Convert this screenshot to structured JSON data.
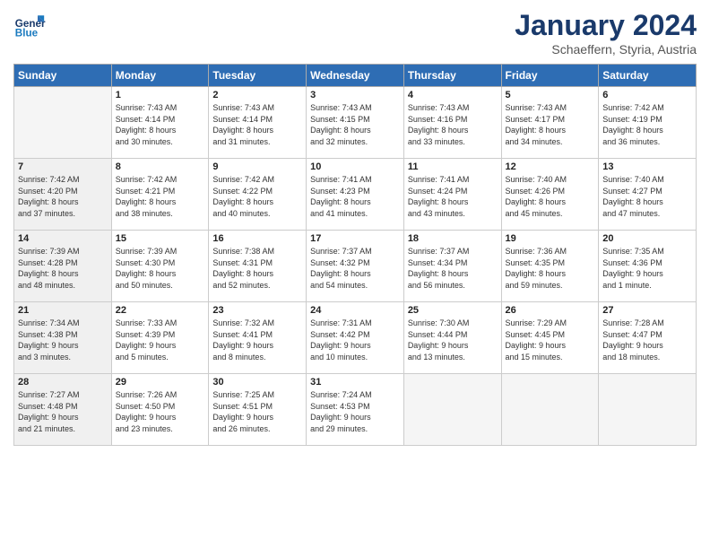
{
  "header": {
    "logo_general": "General",
    "logo_blue": "Blue",
    "month_title": "January 2024",
    "subtitle": "Schaeffern, Styria, Austria"
  },
  "weekdays": [
    "Sunday",
    "Monday",
    "Tuesday",
    "Wednesday",
    "Thursday",
    "Friday",
    "Saturday"
  ],
  "weeks": [
    [
      {
        "day": "",
        "info": "",
        "empty": true
      },
      {
        "day": "1",
        "info": "Sunrise: 7:43 AM\nSunset: 4:14 PM\nDaylight: 8 hours\nand 30 minutes."
      },
      {
        "day": "2",
        "info": "Sunrise: 7:43 AM\nSunset: 4:14 PM\nDaylight: 8 hours\nand 31 minutes."
      },
      {
        "day": "3",
        "info": "Sunrise: 7:43 AM\nSunset: 4:15 PM\nDaylight: 8 hours\nand 32 minutes."
      },
      {
        "day": "4",
        "info": "Sunrise: 7:43 AM\nSunset: 4:16 PM\nDaylight: 8 hours\nand 33 minutes."
      },
      {
        "day": "5",
        "info": "Sunrise: 7:43 AM\nSunset: 4:17 PM\nDaylight: 8 hours\nand 34 minutes."
      },
      {
        "day": "6",
        "info": "Sunrise: 7:42 AM\nSunset: 4:19 PM\nDaylight: 8 hours\nand 36 minutes."
      }
    ],
    [
      {
        "day": "7",
        "info": "Sunrise: 7:42 AM\nSunset: 4:20 PM\nDaylight: 8 hours\nand 37 minutes.",
        "shaded": true
      },
      {
        "day": "8",
        "info": "Sunrise: 7:42 AM\nSunset: 4:21 PM\nDaylight: 8 hours\nand 38 minutes."
      },
      {
        "day": "9",
        "info": "Sunrise: 7:42 AM\nSunset: 4:22 PM\nDaylight: 8 hours\nand 40 minutes."
      },
      {
        "day": "10",
        "info": "Sunrise: 7:41 AM\nSunset: 4:23 PM\nDaylight: 8 hours\nand 41 minutes."
      },
      {
        "day": "11",
        "info": "Sunrise: 7:41 AM\nSunset: 4:24 PM\nDaylight: 8 hours\nand 43 minutes."
      },
      {
        "day": "12",
        "info": "Sunrise: 7:40 AM\nSunset: 4:26 PM\nDaylight: 8 hours\nand 45 minutes."
      },
      {
        "day": "13",
        "info": "Sunrise: 7:40 AM\nSunset: 4:27 PM\nDaylight: 8 hours\nand 47 minutes."
      }
    ],
    [
      {
        "day": "14",
        "info": "Sunrise: 7:39 AM\nSunset: 4:28 PM\nDaylight: 8 hours\nand 48 minutes.",
        "shaded": true
      },
      {
        "day": "15",
        "info": "Sunrise: 7:39 AM\nSunset: 4:30 PM\nDaylight: 8 hours\nand 50 minutes."
      },
      {
        "day": "16",
        "info": "Sunrise: 7:38 AM\nSunset: 4:31 PM\nDaylight: 8 hours\nand 52 minutes."
      },
      {
        "day": "17",
        "info": "Sunrise: 7:37 AM\nSunset: 4:32 PM\nDaylight: 8 hours\nand 54 minutes."
      },
      {
        "day": "18",
        "info": "Sunrise: 7:37 AM\nSunset: 4:34 PM\nDaylight: 8 hours\nand 56 minutes."
      },
      {
        "day": "19",
        "info": "Sunrise: 7:36 AM\nSunset: 4:35 PM\nDaylight: 8 hours\nand 59 minutes."
      },
      {
        "day": "20",
        "info": "Sunrise: 7:35 AM\nSunset: 4:36 PM\nDaylight: 9 hours\nand 1 minute."
      }
    ],
    [
      {
        "day": "21",
        "info": "Sunrise: 7:34 AM\nSunset: 4:38 PM\nDaylight: 9 hours\nand 3 minutes.",
        "shaded": true
      },
      {
        "day": "22",
        "info": "Sunrise: 7:33 AM\nSunset: 4:39 PM\nDaylight: 9 hours\nand 5 minutes."
      },
      {
        "day": "23",
        "info": "Sunrise: 7:32 AM\nSunset: 4:41 PM\nDaylight: 9 hours\nand 8 minutes."
      },
      {
        "day": "24",
        "info": "Sunrise: 7:31 AM\nSunset: 4:42 PM\nDaylight: 9 hours\nand 10 minutes."
      },
      {
        "day": "25",
        "info": "Sunrise: 7:30 AM\nSunset: 4:44 PM\nDaylight: 9 hours\nand 13 minutes."
      },
      {
        "day": "26",
        "info": "Sunrise: 7:29 AM\nSunset: 4:45 PM\nDaylight: 9 hours\nand 15 minutes."
      },
      {
        "day": "27",
        "info": "Sunrise: 7:28 AM\nSunset: 4:47 PM\nDaylight: 9 hours\nand 18 minutes."
      }
    ],
    [
      {
        "day": "28",
        "info": "Sunrise: 7:27 AM\nSunset: 4:48 PM\nDaylight: 9 hours\nand 21 minutes.",
        "shaded": true
      },
      {
        "day": "29",
        "info": "Sunrise: 7:26 AM\nSunset: 4:50 PM\nDaylight: 9 hours\nand 23 minutes."
      },
      {
        "day": "30",
        "info": "Sunrise: 7:25 AM\nSunset: 4:51 PM\nDaylight: 9 hours\nand 26 minutes."
      },
      {
        "day": "31",
        "info": "Sunrise: 7:24 AM\nSunset: 4:53 PM\nDaylight: 9 hours\nand 29 minutes."
      },
      {
        "day": "",
        "info": "",
        "empty": true
      },
      {
        "day": "",
        "info": "",
        "empty": true
      },
      {
        "day": "",
        "info": "",
        "empty": true
      }
    ]
  ]
}
